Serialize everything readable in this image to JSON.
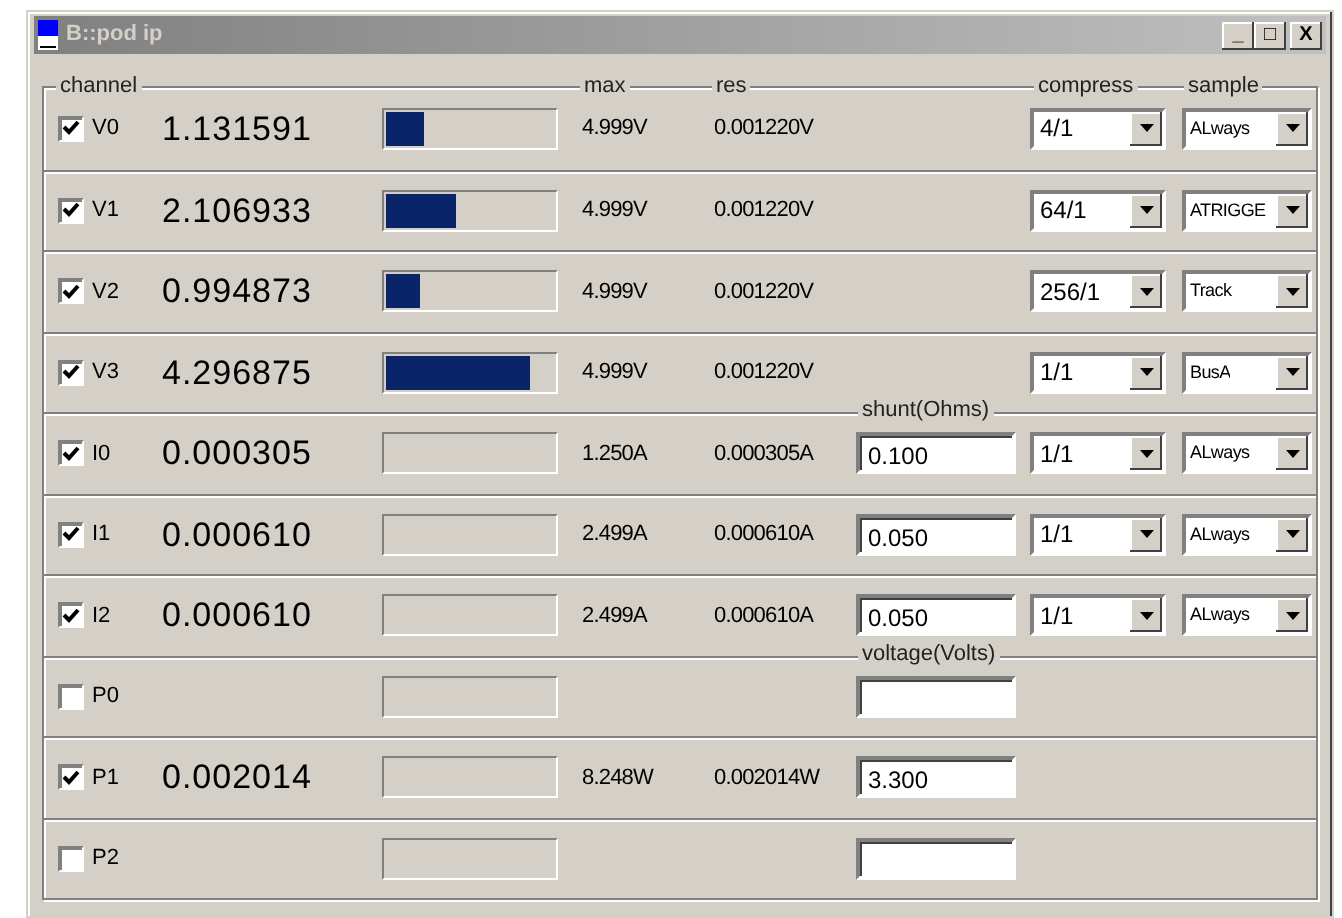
{
  "window": {
    "title": "B::pod ip",
    "controls": [
      "_",
      "□",
      "X"
    ]
  },
  "headers": {
    "channel": "channel",
    "max": "max",
    "res": "res",
    "compress": "compress",
    "sample": "sample"
  },
  "groups": [
    {
      "rows": [
        {
          "kind": "voltage",
          "name": "V0",
          "checked": true,
          "value": "1.131591",
          "level": 0.23,
          "max": "4.999V",
          "res": "0.001220V",
          "compress": "4/1",
          "sample": "ALways"
        },
        {
          "kind": "voltage",
          "name": "V1",
          "checked": true,
          "value": "2.106933",
          "level": 0.42,
          "max": "4.999V",
          "res": "0.001220V",
          "compress": "64/1",
          "sample": "ATRIGGE"
        },
        {
          "kind": "voltage",
          "name": "V2",
          "checked": true,
          "value": "0.994873",
          "level": 0.2,
          "max": "4.999V",
          "res": "0.001220V",
          "compress": "256/1",
          "sample": "Track"
        },
        {
          "kind": "voltage",
          "name": "V3",
          "checked": true,
          "value": "4.296875",
          "level": 0.86,
          "max": "4.999V",
          "res": "0.001220V",
          "compress": "1/1",
          "sample": "BusA"
        }
      ]
    },
    {
      "field_header": "shunt(Ohms)",
      "rows": [
        {
          "kind": "current",
          "name": "I0",
          "checked": true,
          "value": "0.000305",
          "level": 0,
          "max": "1.250A",
          "res": "0.000305A",
          "field": "0.100",
          "compress": "1/1",
          "sample": "ALways"
        },
        {
          "kind": "current",
          "name": "I1",
          "checked": true,
          "value": "0.000610",
          "level": 0,
          "max": "2.499A",
          "res": "0.000610A",
          "field": "0.050",
          "compress": "1/1",
          "sample": "ALways"
        },
        {
          "kind": "current",
          "name": "I2",
          "checked": true,
          "value": "0.000610",
          "level": 0,
          "max": "2.499A",
          "res": "0.000610A",
          "field": "0.050",
          "compress": "1/1",
          "sample": "ALways"
        }
      ]
    },
    {
      "field_header": "voltage(Volts)",
      "rows": [
        {
          "kind": "power",
          "name": "P0",
          "checked": false,
          "level": 0
        },
        {
          "kind": "power",
          "name": "P1",
          "checked": true,
          "value": "0.002014",
          "level": 0,
          "max": "8.248W",
          "res": "0.002014W",
          "field": "3.300"
        },
        {
          "kind": "power",
          "name": "P2",
          "checked": false,
          "level": 0
        }
      ]
    }
  ]
}
